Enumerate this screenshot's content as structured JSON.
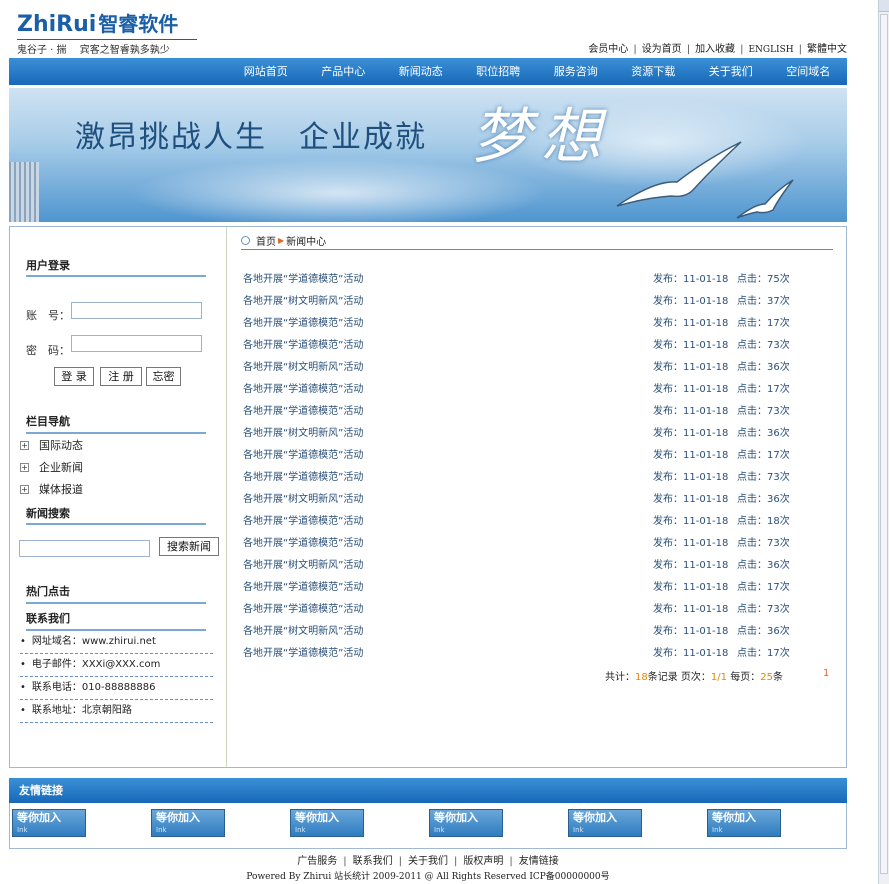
{
  "logo": {
    "brand_a": "Zhi",
    "brand_b": "Rui",
    "brand_cn": "智睿软件",
    "tagline": "鬼谷子 · 揣　 宾客之智睿孰多孰少"
  },
  "toplinks": [
    "会员中心",
    "设为首页",
    "加入收藏",
    "ENGLISH",
    "繁體中文"
  ],
  "nav": [
    "网站首页",
    "产品中心",
    "新闻动态",
    "职位招聘",
    "服务咨询",
    "资源下载",
    "关于我们",
    "空间域名"
  ],
  "banner": {
    "slogan": "激昂挑战人生　企业成就",
    "dream": "梦想"
  },
  "login": {
    "title": "用户登录",
    "account_label": "账　号：",
    "password_label": "密　码：",
    "account_value": "",
    "password_value": "",
    "login_btn": "登 录",
    "register_btn": "注 册",
    "forgot_btn": "忘密"
  },
  "category": {
    "title": "栏目导航",
    "items": [
      "国际动态",
      "企业新闻",
      "媒体报道"
    ]
  },
  "news_search": {
    "title": "新闻搜索",
    "value": "",
    "button": "搜索新闻"
  },
  "hot": {
    "title": "热门点击"
  },
  "contact": {
    "title": "联系我们",
    "items": [
      "网址域名：www.zhirui.net",
      "电子邮件：XXXi@XXX.com",
      "联系电话：010-88888886",
      "联系地址：北京朝阳路"
    ]
  },
  "breadcrumb": {
    "home": "首页",
    "current": "新闻中心"
  },
  "news": [
    {
      "title": "各地开展“学道德模范”活动",
      "date": "发布：11-01-18",
      "hits": "点击：75次"
    },
    {
      "title": "各地开展“树文明新风”活动",
      "date": "发布：11-01-18",
      "hits": "点击：37次"
    },
    {
      "title": "各地开展“学道德模范”活动",
      "date": "发布：11-01-18",
      "hits": "点击：17次"
    },
    {
      "title": "各地开展“学道德模范”活动",
      "date": "发布：11-01-18",
      "hits": "点击：73次"
    },
    {
      "title": "各地开展“树文明新风”活动",
      "date": "发布：11-01-18",
      "hits": "点击：36次"
    },
    {
      "title": "各地开展“学道德模范”活动",
      "date": "发布：11-01-18",
      "hits": "点击：17次"
    },
    {
      "title": "各地开展“学道德模范”活动",
      "date": "发布：11-01-18",
      "hits": "点击：73次"
    },
    {
      "title": "各地开展“树文明新风”活动",
      "date": "发布：11-01-18",
      "hits": "点击：36次"
    },
    {
      "title": "各地开展“学道德模范”活动",
      "date": "发布：11-01-18",
      "hits": "点击：17次"
    },
    {
      "title": "各地开展“学道德模范”活动",
      "date": "发布：11-01-18",
      "hits": "点击：73次"
    },
    {
      "title": "各地开展“树文明新风”活动",
      "date": "发布：11-01-18",
      "hits": "点击：36次"
    },
    {
      "title": "各地开展“学道德模范”活动",
      "date": "发布：11-01-18",
      "hits": "点击：18次"
    },
    {
      "title": "各地开展“学道德模范”活动",
      "date": "发布：11-01-18",
      "hits": "点击：73次"
    },
    {
      "title": "各地开展“树文明新风”活动",
      "date": "发布：11-01-18",
      "hits": "点击：36次"
    },
    {
      "title": "各地开展“学道德模范”活动",
      "date": "发布：11-01-18",
      "hits": "点击：17次"
    },
    {
      "title": "各地开展“学道德模范”活动",
      "date": "发布：11-01-18",
      "hits": "点击：73次"
    },
    {
      "title": "各地开展“树文明新风”活动",
      "date": "发布：11-01-18",
      "hits": "点击：36次"
    },
    {
      "title": "各地开展“学道德模范”活动",
      "date": "发布：11-01-18",
      "hits": "点击：17次"
    }
  ],
  "pager": {
    "total_prefix": "共计：",
    "total": "18",
    "total_suffix": "条记录 页次：",
    "page": "1/1",
    "per_prefix": " 每页：",
    "per": "25",
    "per_suffix": "条",
    "page_link": "1"
  },
  "friend_links": {
    "title": "友情链接",
    "box_label": "等你加入",
    "box_sub": "Ink",
    "count": 6
  },
  "footer": {
    "links": [
      "广告服务",
      "联系我们",
      "关于我们",
      "版权声明",
      "友情链接"
    ],
    "copyright": "Powered By Zhirui 站长统计 2009-2011 @ All Rights Reserved ICP备00000000号"
  },
  "colors": {
    "nav_blue": "#1769b8",
    "accent_orange": "#d96a2e",
    "link_blue": "#2a4f7a"
  }
}
